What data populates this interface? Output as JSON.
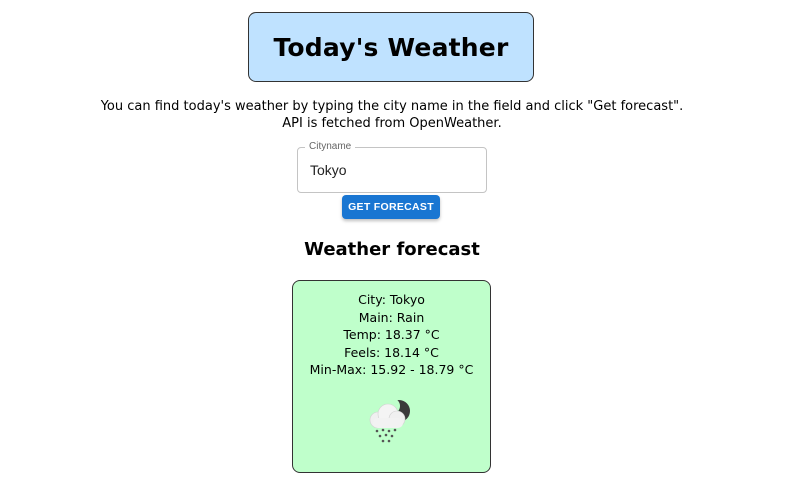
{
  "header": {
    "title": "Today's Weather"
  },
  "description": {
    "line1": "You can find today's weather by typing the city name in the field and click \"Get forecast\".",
    "line2": "API is fetched from OpenWeather."
  },
  "search": {
    "label": "Cityname",
    "value": "Tokyo"
  },
  "button": {
    "label": "GET FORECAST"
  },
  "forecast": {
    "heading": "Weather forecast",
    "city": "City: Tokyo",
    "main": "Main: Rain",
    "temp": "Temp: 18.37 °C",
    "feels": "Feels: 18.14 °C",
    "minmax": "Min-Max: 15.92 - 18.79 °C",
    "icon": "rain-cloud-moon-icon"
  },
  "colors": {
    "title_bg": "#bfe2ff",
    "card_bg": "#bfffcb",
    "button_bg": "#1976d2"
  }
}
